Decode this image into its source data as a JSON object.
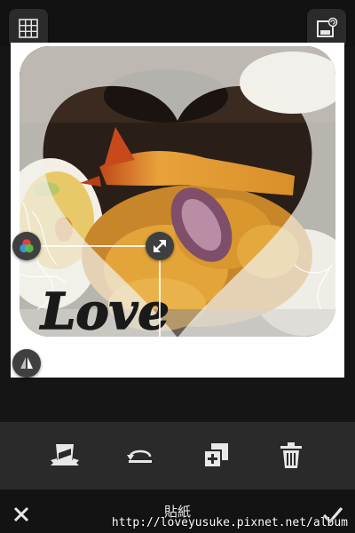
{
  "top_bar": {
    "grid_icon": "grid-icon",
    "frame_icon": "photo-frame-settings-icon"
  },
  "canvas": {
    "sticker_text": "Love",
    "handles": {
      "color": "color-palette-icon",
      "resize": "resize-arrows-icon",
      "flip": "flip-icon"
    },
    "overlay_color": "#f0f0ea",
    "heart_shape": "heart"
  },
  "toolbar": {
    "items": [
      {
        "name": "sticker-style-icon"
      },
      {
        "name": "flip-horizontal-icon"
      },
      {
        "name": "duplicate-icon"
      },
      {
        "name": "trash-icon"
      }
    ]
  },
  "bottom_bar": {
    "title": "貼紙",
    "cancel_icon": "close-icon",
    "confirm_icon": "checkmark-icon"
  },
  "watermark": "http://loveyusuke.pixnet.net/album"
}
